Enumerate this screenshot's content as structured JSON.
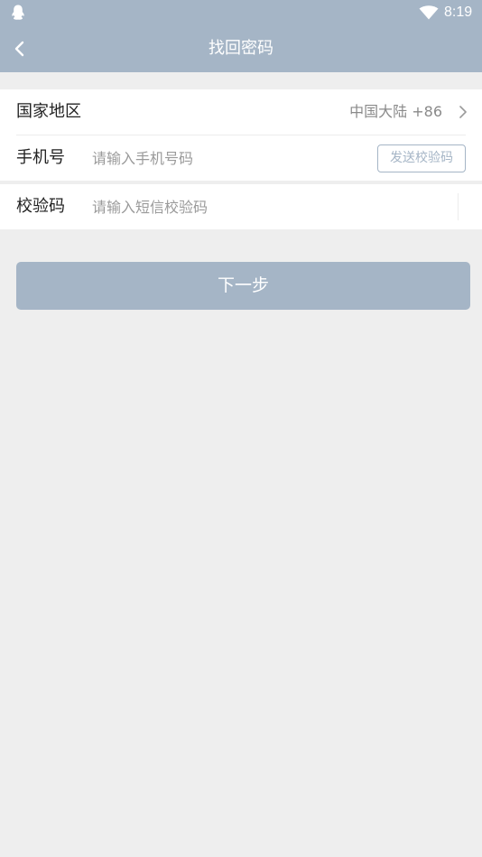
{
  "status_bar": {
    "time": "8:19",
    "left_icon": "qq-penguin-icon",
    "right_icon": "wifi-icon"
  },
  "header": {
    "title": "找回密码",
    "back_icon": "chevron-left-icon"
  },
  "form": {
    "region": {
      "label": "国家地区",
      "value": "中国大陆 +86",
      "icon": "chevron-right-icon"
    },
    "phone": {
      "label": "手机号",
      "placeholder": "请输入手机号码",
      "value": "",
      "send_code_label": "发送校验码"
    },
    "code": {
      "label": "校验码",
      "placeholder": "请输入短信校验码",
      "value": ""
    }
  },
  "next_button": {
    "label": "下一步"
  },
  "colors": {
    "header_bg": "#a5b5c6",
    "page_bg": "#eeeeee",
    "card_bg": "#ffffff",
    "accent": "#a5b5c6"
  }
}
